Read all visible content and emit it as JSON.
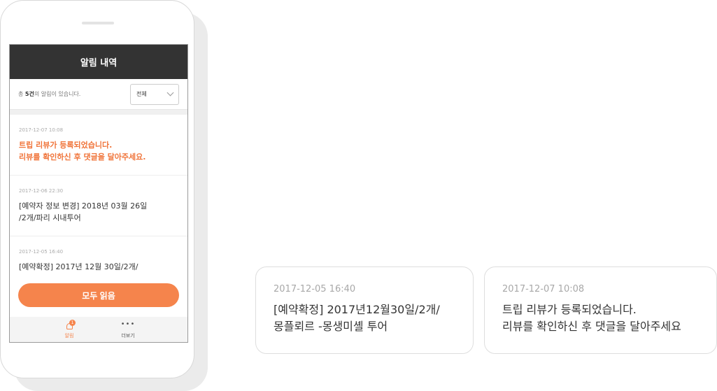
{
  "app": {
    "header_title": "알림 내역",
    "summary_prefix": "총 ",
    "summary_count": "5건",
    "summary_suffix": "의 알림이 있습니다.",
    "filter_value": "전체",
    "read_all_label": "모두 읽음"
  },
  "notifications": [
    {
      "time": "2017-12-07 10:08",
      "message": "트립 리뷰가 등록되었습니다.\n리뷰를 확인하신 후 댓글을 달아주세요.",
      "highlight": true
    },
    {
      "time": "2017-12-06 22:30",
      "message": "[예약자 정보 변경] 2018년 03월 26일\n/2개/파리 시내투어",
      "highlight": false
    },
    {
      "time": "2017-12-05 16:40",
      "message": "[예약확정] 2017년 12월 30일/2개/",
      "highlight": false
    }
  ],
  "tabbar": {
    "alerts_label": "알림",
    "alerts_badge": "1",
    "more_label": "더보기",
    "more_icon": "ellipsis-icon"
  },
  "cards": [
    {
      "time": "2017-12-05 16:40",
      "message": "[예약확정] 2017년12월30일/2개/\n몽플뢰르 -몽생미셸 투어"
    },
    {
      "time": "2017-12-07 10:08",
      "message": "트립 리뷰가 등록되었습니다.\n리뷰를 확인하신 후 댓글을 달아주세요"
    }
  ],
  "colors": {
    "accent": "#f5844c",
    "header_bg": "#333333"
  }
}
